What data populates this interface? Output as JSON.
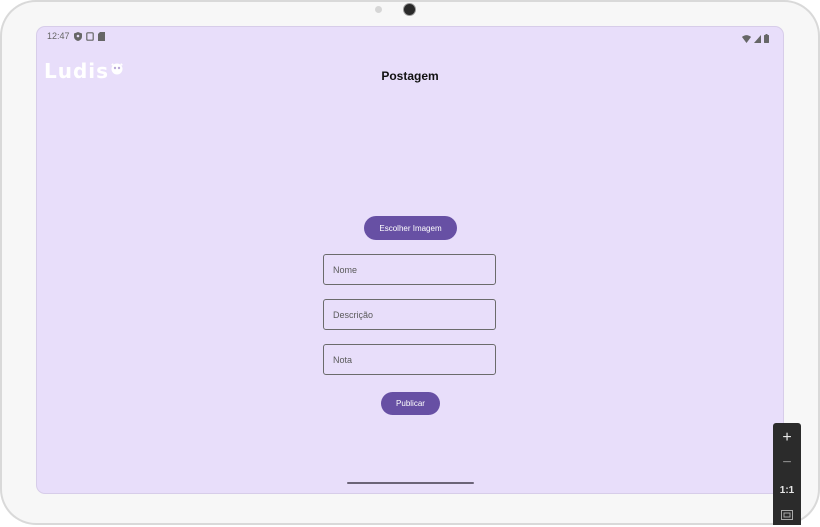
{
  "status_bar": {
    "time": "12:47",
    "left_icons": [
      "shield-icon",
      "screen-icon",
      "sd-card-icon"
    ],
    "right_icons": [
      "wifi-icon",
      "signal-icon",
      "battery-icon"
    ]
  },
  "app": {
    "logo": "Ludis",
    "title": "Postagem",
    "choose_image_label": "Escolher Imagem",
    "fields": {
      "nome_placeholder": "Nome",
      "descricao_placeholder": "Descrição",
      "nota_placeholder": "Nota"
    },
    "publish_label": "Publicar"
  },
  "emulator_zoom": {
    "zoom_in": "+",
    "zoom_out": "−",
    "actual_size": "1:1"
  },
  "colors": {
    "screen_bg": "#e8defa",
    "primary": "#6750a4"
  }
}
